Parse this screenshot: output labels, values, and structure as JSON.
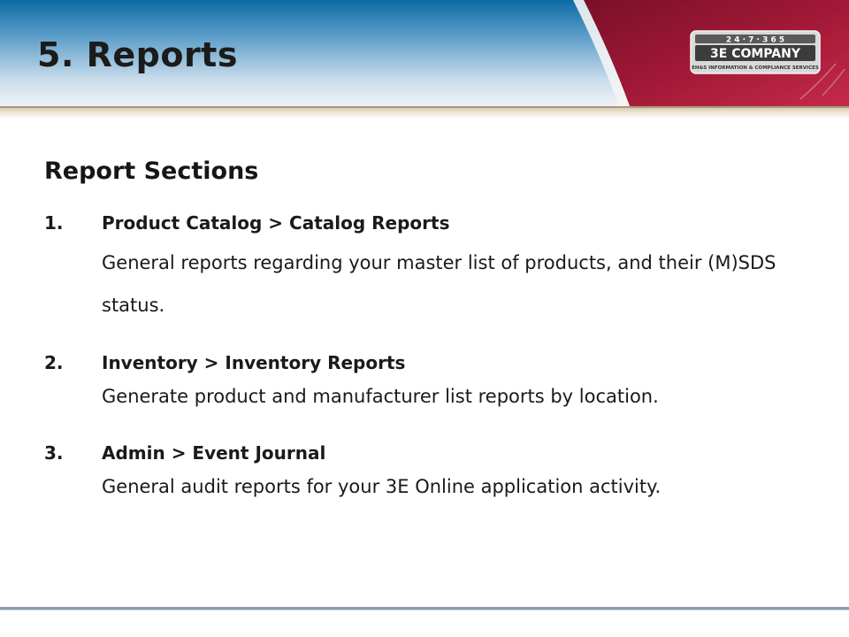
{
  "slide": {
    "title": "5. Reports",
    "section_heading": "Report Sections",
    "items": [
      {
        "number": "1.",
        "title": "Product Catalog > Catalog Reports",
        "description": "General reports regarding your master list of products, and their (M)SDS status."
      },
      {
        "number": "2.",
        "title": "Inventory > Inventory Reports",
        "description": "Generate product and manufacturer list reports by location."
      },
      {
        "number": "3.",
        "title": "Admin > Event Journal",
        "description": "General audit reports for your 3E Online application activity."
      }
    ]
  },
  "logo": {
    "top_text": "2 4 · 7 · 3 6 5",
    "name": "3E COMPANY",
    "tagline": "EH&S Information & Compliance Services"
  },
  "colors": {
    "header_blue": "#0d6aa3",
    "header_red": "#8c1430",
    "accent_tan": "#cdbfa3"
  }
}
